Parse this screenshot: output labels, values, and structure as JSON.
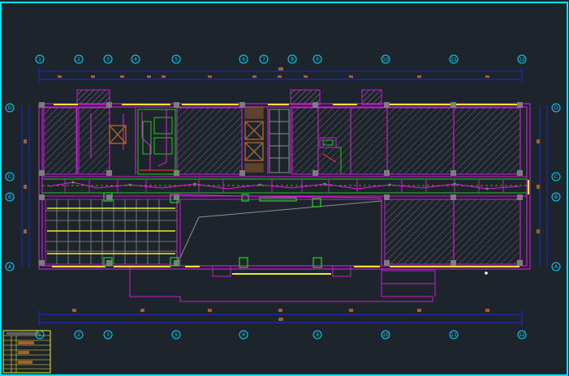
{
  "drawing": {
    "background": "#1e242b",
    "frame_color": "#00e5ff",
    "colors": {
      "wall": "#c51fd1",
      "dim": "#1c27d6",
      "equip": "#22c81d",
      "highlight": "#f2ea2a",
      "hatch": "#7a7f86",
      "column": "#7d7d7d",
      "axis_bubble": "#00d8ff",
      "tag": "#a06030",
      "detail_red": "#ff3b30"
    },
    "axes_top": [
      "1",
      "2",
      "3",
      "4",
      "5",
      "6",
      "7",
      "8",
      "9",
      "10",
      "11",
      "12"
    ],
    "axes_bottom": [
      "1",
      "2",
      "3",
      "5",
      "6",
      "9",
      "10",
      "11",
      "12"
    ],
    "axes_side": [
      "D",
      "C",
      "B",
      "A"
    ]
  },
  "title_block": {
    "visible_text": ""
  }
}
